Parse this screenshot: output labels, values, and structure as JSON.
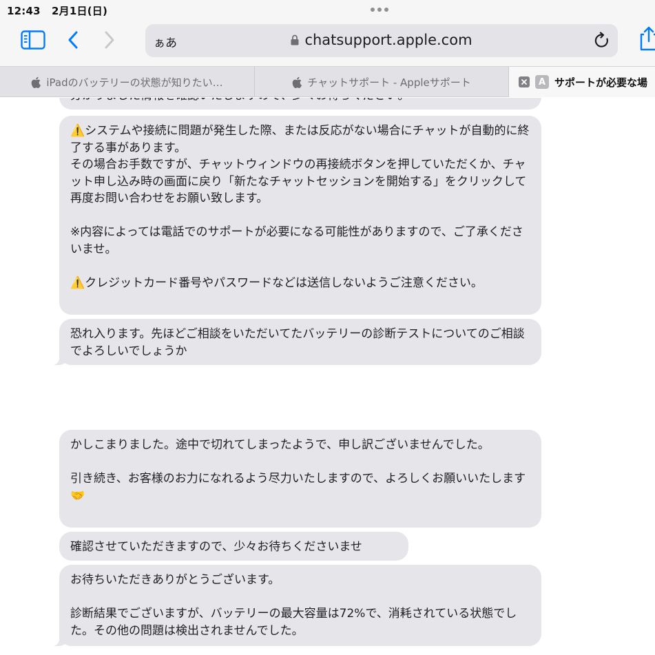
{
  "status_bar": {
    "time": "12:43",
    "date": "2月1日(日)"
  },
  "toolbar": {
    "sidebar_icon": "sidebar-icon",
    "back_icon": "chevron-left-icon",
    "forward_icon": "chevron-right-icon",
    "reader_label": "ぁあ",
    "url": "chatsupport.apple.com",
    "reload_icon": "reload-icon",
    "share_icon": "share-icon",
    "accent": "#007aff"
  },
  "tabs": [
    {
      "label": "iPadのバッテリーの状態が知りたい…",
      "icon": "apple-icon",
      "active": false
    },
    {
      "label": "チャットサポート - Appleサポート",
      "icon": "apple-icon",
      "active": false
    },
    {
      "label": "サポートが必要な場",
      "favicon": "A",
      "active": true
    }
  ],
  "chat": {
    "messages": [
      {
        "text": "分かりました情報を確認いたしますので、少々お待ちください。"
      },
      {
        "text": "⚠️システムや接続に問題が発生した際、または反応がない場合にチャットが自動的に終了する事があります。\nその場合お手数ですが、チャットウィンドウの再接続ボタンを押していただくか、チャット申し込み時の画面に戻り「新たなチャットセッションを開始する」をクリックして再度お問い合わせをお願い致します。\n\n※内容によっては電話でのサポートが必要になる可能性がありますので、ご了承くださいませ。\n\n⚠️クレジットカード番号やパスワードなどは送信しないようご注意ください。"
      },
      {
        "text": "恐れ入ります。先ほどご相談をいただいてたバッテリーの診断テストについてのご相談でよろしいでしょうか"
      },
      {
        "text": "かしこまりました。途中で切れてしまったようで、申し訳ございませんでした。\n\n引き続き、お客様のお力になれるよう尽力いたしますので、よろしくお願いいたします🤝"
      },
      {
        "text": "確認させていただきますので、少々お待ちくださいませ"
      },
      {
        "text": "お待ちいただきありがとうございます。\n\n診断結果でございますが、バッテリーの最大容量は72%で、消耗されている状態でした。その他の問題は検出されませんでした。"
      }
    ],
    "bubble_color": "#e5e5ea"
  }
}
